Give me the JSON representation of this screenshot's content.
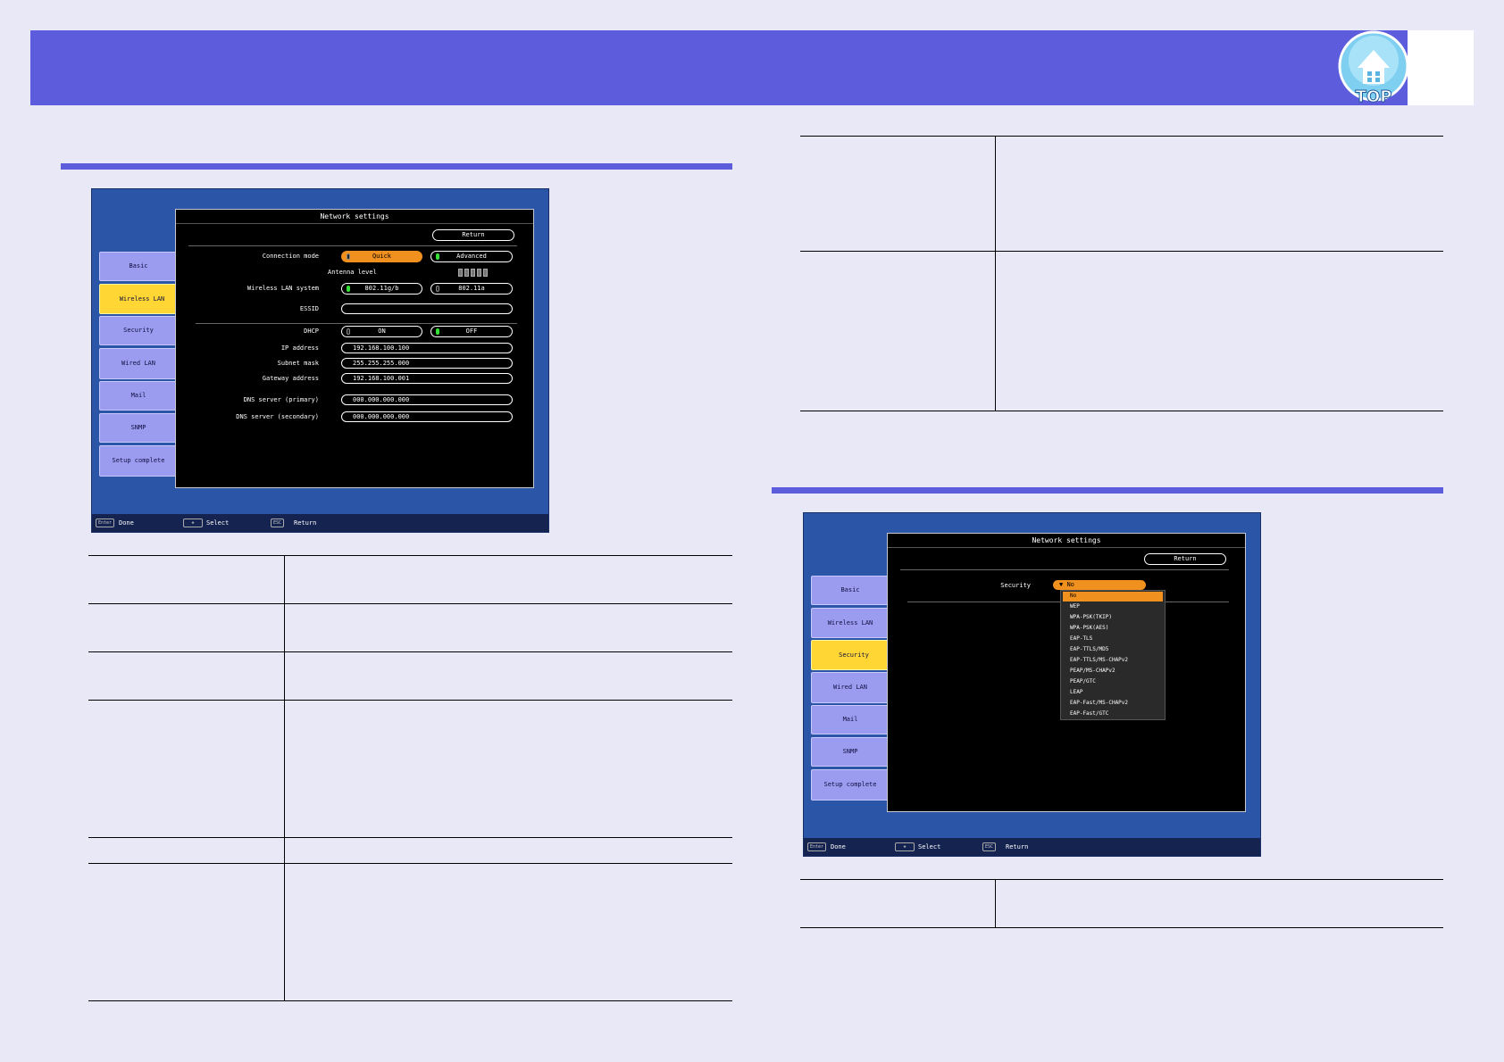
{
  "header": {
    "top_label": "TOP"
  },
  "screen_left": {
    "title": "Network settings",
    "return_label": "Return",
    "tabs": [
      "Basic",
      "Wireless LAN",
      "Security",
      "Wired LAN",
      "Mail",
      "SNMP",
      "Setup complete"
    ],
    "active_tab": "Wireless LAN",
    "rows": {
      "connection_mode": {
        "label": "Connection mode",
        "options": [
          "Quick",
          "Advanced"
        ],
        "selected": "Quick"
      },
      "antenna_level": {
        "label": "Antenna level"
      },
      "wireless_lan_system": {
        "label": "Wireless LAN system",
        "options": [
          "802.11g/b",
          "802.11a"
        ],
        "selected": "802.11g/b"
      },
      "essid": {
        "label": "ESSID",
        "value": ""
      },
      "dhcp": {
        "label": "DHCP",
        "options": [
          "ON",
          "OFF"
        ],
        "selected": "OFF"
      },
      "ip_address": {
        "label": "IP address",
        "value": "192.168.100.100"
      },
      "subnet_mask": {
        "label": "Subnet mask",
        "value": "255.255.255.000"
      },
      "gateway_address": {
        "label": "Gateway address",
        "value": "192.168.100.001"
      },
      "dns_primary": {
        "label": "DNS server (primary)",
        "value": "000.000.000.000"
      },
      "dns_secondary": {
        "label": "DNS server (secondary)",
        "value": "000.000.000.000"
      }
    },
    "footer": {
      "enter_key": "Enter",
      "enter_label": "Done",
      "select_label": "Select",
      "esc_key": "ESC",
      "esc_label": "Return"
    }
  },
  "screen_right": {
    "title": "Network settings",
    "return_label": "Return",
    "tabs": [
      "Basic",
      "Wireless LAN",
      "Security",
      "Wired LAN",
      "Mail",
      "SNMP",
      "Setup complete"
    ],
    "active_tab": "Security",
    "security_label": "Security",
    "security_value": "No",
    "security_options": [
      "No",
      "WEP",
      "WPA-PSK(TKIP)",
      "WPA-PSK(AES)",
      "EAP-TLS",
      "EAP-TTLS/MD5",
      "EAP-TTLS/MS-CHAPv2",
      "PEAP/MS-CHAPv2",
      "PEAP/GTC",
      "LEAP",
      "EAP-Fast/MS-CHAPv2",
      "EAP-Fast/GTC"
    ],
    "footer": {
      "enter_key": "Enter",
      "enter_label": "Done",
      "select_label": "Select",
      "esc_key": "ESC",
      "esc_label": "Return"
    }
  }
}
